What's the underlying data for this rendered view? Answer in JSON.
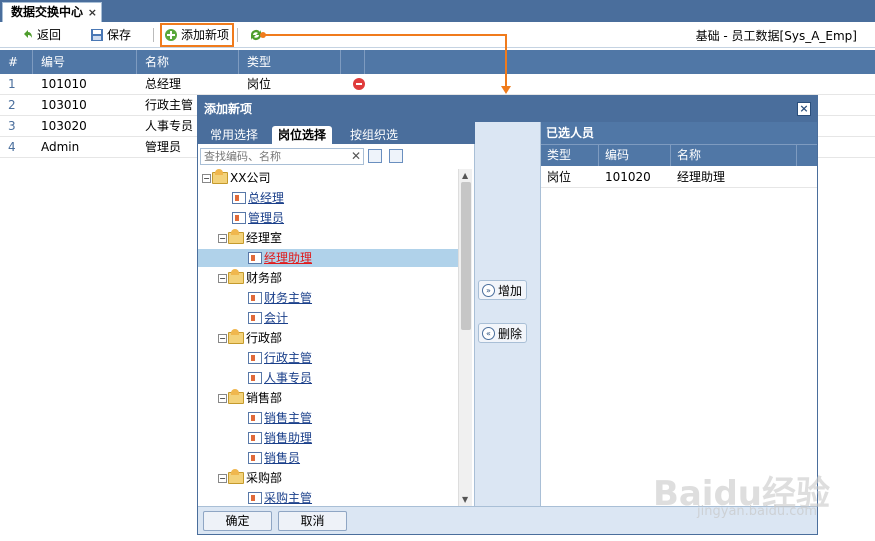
{
  "tab": {
    "title": "数据交换中心",
    "close": "×"
  },
  "toolbar": {
    "back_label": "返回",
    "save_label": "保存",
    "add_label": "添加新项",
    "breadcrumb": "基础 - 员工数据[Sys_A_Emp]"
  },
  "grid": {
    "headers": [
      "#",
      "编号",
      "名称",
      "类型"
    ],
    "rows": [
      {
        "num": "1",
        "code": "101010",
        "name": "总经理",
        "type": "岗位"
      },
      {
        "num": "2",
        "code": "103010",
        "name": "行政主管",
        "type": ""
      },
      {
        "num": "3",
        "code": "103020",
        "name": "人事专员",
        "type": ""
      },
      {
        "num": "4",
        "code": "Admin",
        "name": "管理员",
        "type": ""
      }
    ]
  },
  "dialog": {
    "title": "添加新项",
    "close": "×",
    "tabs": [
      "常用选择",
      "岗位选择",
      "按组织选"
    ],
    "search_placeholder": "查找编码、名称",
    "tree": [
      {
        "label": "XX公司",
        "level": 0,
        "kind": "folder"
      },
      {
        "label": "总经理",
        "level": 1,
        "kind": "leaf"
      },
      {
        "label": "管理员",
        "level": 1,
        "kind": "leaf"
      },
      {
        "label": "经理室",
        "level": 1,
        "kind": "folder"
      },
      {
        "label": "经理助理",
        "level": 2,
        "kind": "leaf",
        "selected": true
      },
      {
        "label": "财务部",
        "level": 1,
        "kind": "folder"
      },
      {
        "label": "财务主管",
        "level": 2,
        "kind": "leaf"
      },
      {
        "label": "会计",
        "level": 2,
        "kind": "leaf"
      },
      {
        "label": "行政部",
        "level": 1,
        "kind": "folder"
      },
      {
        "label": "行政主管",
        "level": 2,
        "kind": "leaf"
      },
      {
        "label": "人事专员",
        "level": 2,
        "kind": "leaf"
      },
      {
        "label": "销售部",
        "level": 1,
        "kind": "folder"
      },
      {
        "label": "销售主管",
        "level": 2,
        "kind": "leaf"
      },
      {
        "label": "销售助理",
        "level": 2,
        "kind": "leaf"
      },
      {
        "label": "销售员",
        "level": 2,
        "kind": "leaf"
      },
      {
        "label": "采购部",
        "level": 1,
        "kind": "folder"
      },
      {
        "label": "采购主管",
        "level": 2,
        "kind": "leaf"
      }
    ],
    "add_button": "增加",
    "remove_button": "删除",
    "selected_title": "已选人员",
    "selected_headers": [
      "类型",
      "编码",
      "名称"
    ],
    "selected_rows": [
      {
        "type": "岗位",
        "code": "101020",
        "name": "经理助理"
      }
    ],
    "ok_label": "确定",
    "cancel_label": "取消"
  },
  "watermark": {
    "main": "Baidu经验",
    "sub": "jingyan.baidu.com"
  },
  "colors": {
    "header_blue": "#4a6e9c",
    "highlight_orange": "#f07b1c",
    "selected_red": "#e01a1a",
    "link_blue": "#1a3f8a"
  }
}
